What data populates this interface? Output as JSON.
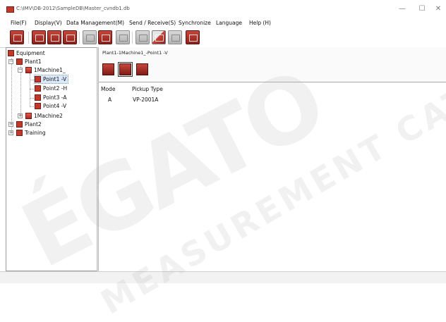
{
  "window": {
    "title": "C:\\IMV\\DB-2012\\SampleDB\\Master_cvndb1.db"
  },
  "menu": {
    "items": [
      "File(F)",
      "Display(V)",
      "Data Management(M)",
      "Send / Receive(S)",
      "Synchronize",
      "Language",
      "Help (H)"
    ]
  },
  "tree": {
    "root": "Equipment",
    "plant1": "Plant1",
    "machine1": "1Machine1_",
    "points": [
      "Point1 -V",
      "Point2 -H",
      "Point3 -A",
      "Point4 -V"
    ],
    "machine2": "1Machine2",
    "plant2": "Plant2",
    "training": "Training",
    "expanded_symbol": "−",
    "collapsed_symbol": "+"
  },
  "detail": {
    "path": "Plant1-1Machine1_-Point1 -V",
    "columns": [
      "Mode",
      "Pickup Type"
    ],
    "rows": [
      {
        "mode": "A",
        "pickup_type": "VP-2001A"
      }
    ]
  },
  "watermark": {
    "line1": "ÉGATO",
    "line2": "MEASUREMENT CATALOG"
  },
  "window_controls": {
    "minimize": "—",
    "maximize": "☐",
    "close": "✕"
  },
  "colors": {
    "accent": "#c0392b",
    "selection": "#d9e8fb"
  }
}
